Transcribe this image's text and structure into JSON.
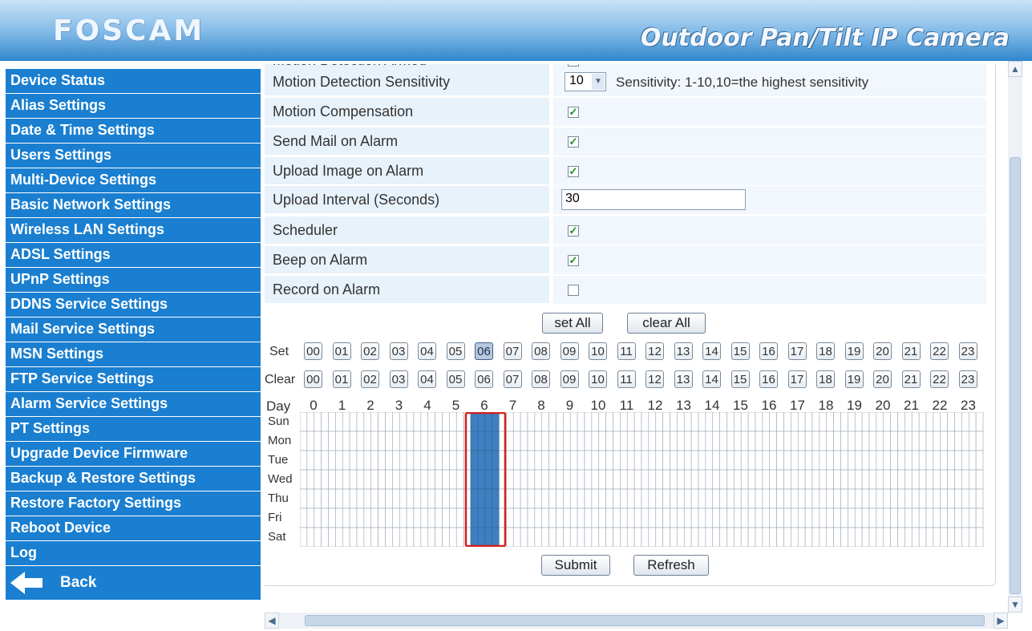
{
  "header": {
    "brand": "FOSCAM",
    "product": "Outdoor Pan/Tilt IP Camera"
  },
  "sidebar": {
    "items": [
      "Device Status",
      "Alias Settings",
      "Date & Time Settings",
      "Users Settings",
      "Multi-Device Settings",
      "Basic Network Settings",
      "Wireless LAN Settings",
      "ADSL Settings",
      "UPnP Settings",
      "DDNS Service Settings",
      "Mail Service Settings",
      "MSN Settings",
      "FTP Service Settings",
      "Alarm Service Settings",
      "PT Settings",
      "Upgrade Device Firmware",
      "Backup & Restore Settings",
      "Restore Factory Settings",
      "Reboot Device",
      "Log"
    ],
    "back_label": "Back"
  },
  "form": {
    "partial_row": "Motion Detection Armed",
    "sensitivity": {
      "label": "Motion Detection Sensitivity",
      "value": "10",
      "hint": "Sensitivity: 1-10,10=the highest sensitivity"
    },
    "rows": [
      {
        "label": "Motion Compensation",
        "checked": true
      },
      {
        "label": "Send Mail on Alarm",
        "checked": true
      },
      {
        "label": "Upload Image on Alarm",
        "checked": true
      }
    ],
    "upload_interval": {
      "label": "Upload Interval (Seconds)",
      "value": "30"
    },
    "rows2": [
      {
        "label": "Scheduler",
        "checked": true
      },
      {
        "label": "Beep on Alarm",
        "checked": true
      },
      {
        "label": "Record on Alarm",
        "checked": false
      }
    ]
  },
  "schedule": {
    "set_all": "set All",
    "clear_all": "clear All",
    "set_label": "Set",
    "clear_label": "Clear",
    "day_label": "Day",
    "hours_padded": [
      "00",
      "01",
      "02",
      "03",
      "04",
      "05",
      "06",
      "07",
      "08",
      "09",
      "10",
      "11",
      "12",
      "13",
      "14",
      "15",
      "16",
      "17",
      "18",
      "19",
      "20",
      "21",
      "22",
      "23"
    ],
    "hours": [
      "0",
      "1",
      "2",
      "3",
      "4",
      "5",
      "6",
      "7",
      "8",
      "9",
      "10",
      "11",
      "12",
      "13",
      "14",
      "15",
      "16",
      "17",
      "18",
      "19",
      "20",
      "21",
      "22",
      "23"
    ],
    "days": [
      "Sun",
      "Mon",
      "Tue",
      "Wed",
      "Thu",
      "Fri",
      "Sat"
    ],
    "active_hour": 6,
    "pressed_set_hour": 6
  },
  "actions": {
    "submit": "Submit",
    "refresh": "Refresh"
  },
  "colors": {
    "nav_bg": "#1a7fd0",
    "active_cell": "#3e7fbf",
    "highlight": "#d42020"
  }
}
